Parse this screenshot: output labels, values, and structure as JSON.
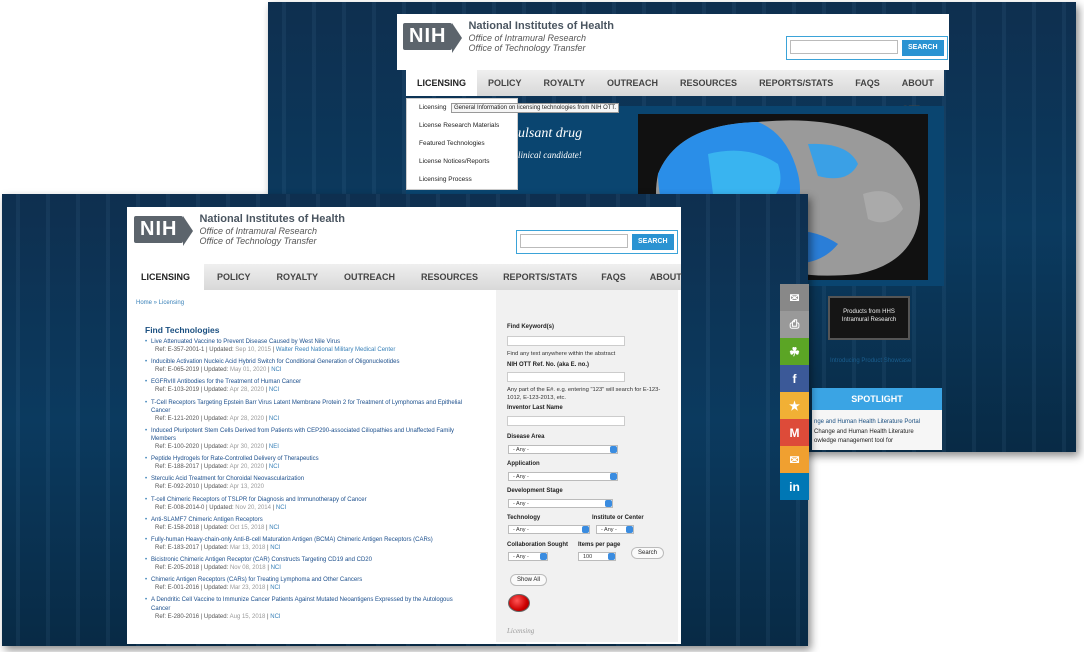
{
  "logo": {
    "abbr": "NIH",
    "line1": "National Institutes of Health",
    "line2": "Office of Intramural Research",
    "line3": "Office of Technology Transfer"
  },
  "search": {
    "button": "SEARCH"
  },
  "nav": [
    "LICENSING",
    "POLICY",
    "ROYALTY",
    "OUTREACH",
    "RESOURCES",
    "REPORTS/STATS",
    "FAQS",
    "ABOUT OTT"
  ],
  "back": {
    "dropdown": [
      "Licensing",
      "License Research Materials",
      "Featured Technologies",
      "License Notices/Reports",
      "Licensing Process"
    ],
    "tooltip": "General Information on licensing technologies from NIH OTT.",
    "hero_line1": "ulsant drug",
    "hero_line2": "linical candidate!",
    "showcase": "Products from HHS Intramural Research",
    "showcase_caption": "Introducing Product Showcase",
    "spotlight": "SPOTLIGHT",
    "spot1": "nge and Human Health Literature Portal",
    "spot2": "Change and Human Health Literature",
    "spot3": "owledge management tool for"
  },
  "front": {
    "breadcrumb": "Home » Licensing",
    "find_title": "Find Technologies",
    "items": [
      {
        "title": "Live Attenuated Vaccine to Prevent Disease Caused by West Nile Virus",
        "ref": "Ref: E-357-2001-1 | Updated:",
        "date": "Sep 10, 2015",
        "ic": "Walter Reed National Military Medical Center"
      },
      {
        "title": "Inducible Activation Nucleic Acid Hybrid Switch for Conditional Generation of Oligonucleotides",
        "ref": "Ref: E-065-2019 | Updated:",
        "date": "May 01, 2020",
        "ic": "NCI"
      },
      {
        "title": "EGFRvIII Antibodies for the Treatment of Human Cancer",
        "ref": "Ref: E-103-2019 | Updated:",
        "date": "Apr 28, 2020",
        "ic": "NCI"
      },
      {
        "title": "T-Cell Receptors Targeting Epstein Barr Virus Latent Membrane Protein 2 for Treatment of Lymphomas and Epithelial Cancer",
        "ref": "Ref: E-121-2020 | Updated:",
        "date": "Apr 28, 2020",
        "ic": "NCI"
      },
      {
        "title": "Induced Pluripotent Stem Cells Derived from Patients with CEP290-associated Ciliopathies and Unaffected Family Members",
        "ref": "Ref: E-100-2020 | Updated:",
        "date": "Apr 30, 2020",
        "ic": "NEI"
      },
      {
        "title": "Peptide Hydrogels for Rate-Controlled Delivery of Therapeutics",
        "ref": "Ref: E-188-2017 | Updated:",
        "date": "Apr 20, 2020",
        "ic": "NCI"
      },
      {
        "title": "Sterculic Acid Treatment for Choroidal Neovascularization",
        "ref": "Ref: E-092-2010 | Updated:",
        "date": "Apr 13, 2020",
        "ic": ""
      },
      {
        "title": "T-cell Chimeric Receptors of TSLPR for Diagnosis and Immunotherapy of Cancer",
        "ref": "Ref: E-008-2014-0 | Updated:",
        "date": "Nov 20, 2014",
        "ic": "NCI"
      },
      {
        "title": "Anti-SLAMF7 Chimeric Antigen Receptors",
        "ref": "Ref: E-158-2018 | Updated:",
        "date": "Oct 15, 2018",
        "ic": "NCI"
      },
      {
        "title": "Fully-human Heavy-chain-only Anti-B-cell Maturation Antigen (BCMA) Chimeric Antigen Receptors (CARs)",
        "ref": "Ref: E-183-2017 | Updated:",
        "date": "Mar 13, 2018",
        "ic": "NCI"
      },
      {
        "title": "Bicistronic Chimeric Antigen Receptor (CAR) Constructs Targeting CD19 and CD20",
        "ref": "Ref: E-205-2018 | Updated:",
        "date": "Nov 08, 2018",
        "ic": "NCI"
      },
      {
        "title": "Chimeric Antigen Receptors (CARs) for Treating Lymphoma and Other Cancers",
        "ref": "Ref: E-001-2016 | Updated:",
        "date": "Mar 23, 2018",
        "ic": "NCI"
      },
      {
        "title": "A Dendritic Cell Vaccine to Immunize Cancer Patients Against Mutated Neoantigens Expressed by the Autologous Cancer",
        "ref": "Ref: E-280-2016 | Updated:",
        "date": "Aug 15, 2018",
        "ic": "NCI"
      }
    ],
    "filters": {
      "keyword_label": "Find Keyword(s)",
      "keyword_help": "Find any text anywhere within the abstract",
      "refno_label": "NIH OTT Ref. No. (aka E. no.)",
      "refno_help": "Any part of the E#. e.g. entering \"123\" will search for E-123-1012, E-123-2013, etc.",
      "inventor_label": "Inventor Last Name",
      "disease_label": "Disease Area",
      "application_label": "Application",
      "stage_label": "Development Stage",
      "technology_label": "Technology",
      "institute_label": "Institute or Center",
      "collab_label": "Collaboration Sought",
      "items_label": "Items per page",
      "any": "- Any -",
      "items_value": "100",
      "search_btn": "Search",
      "showall_btn": "Show All",
      "licensing": "Licensing"
    }
  },
  "share": [
    {
      "name": "email",
      "glyph": "✉",
      "color": "#888888"
    },
    {
      "name": "print",
      "glyph": "⎙",
      "color": "#999999"
    },
    {
      "name": "evernote",
      "glyph": "☘",
      "color": "#5ba525"
    },
    {
      "name": "facebook",
      "glyph": "f",
      "color": "#3b5998"
    },
    {
      "name": "favorite",
      "glyph": "★",
      "color": "#f1b035"
    },
    {
      "name": "gmail",
      "glyph": "M",
      "color": "#dd4b39"
    },
    {
      "name": "mail",
      "glyph": "✉",
      "color": "#f0a030"
    },
    {
      "name": "linkedin",
      "glyph": "in",
      "color": "#0077b5"
    }
  ]
}
